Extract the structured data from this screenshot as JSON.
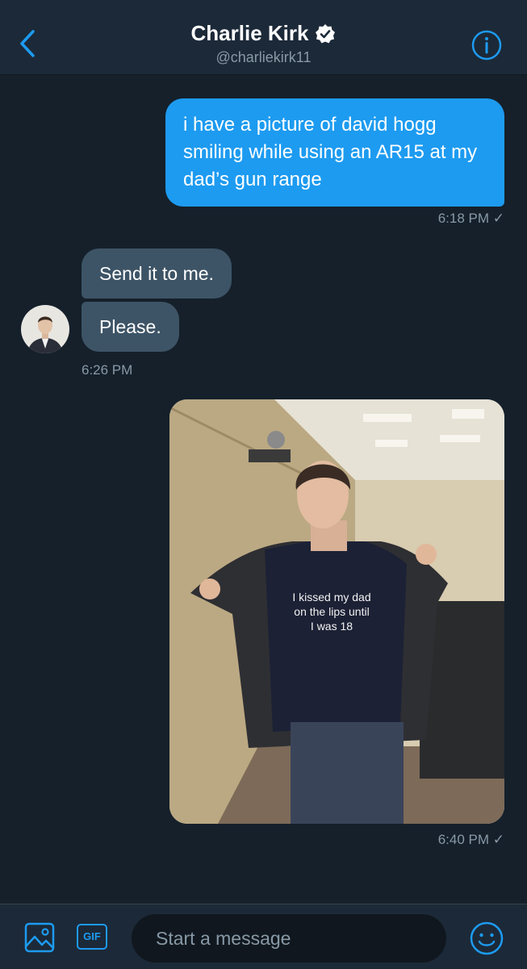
{
  "header": {
    "title": "Charlie Kirk",
    "handle": "@charliekirk11",
    "back_icon": "chevron-left-icon",
    "verified_icon": "verified-badge-icon",
    "info_icon": "info-icon"
  },
  "messages": [
    {
      "direction": "outgoing",
      "type": "text",
      "text": "i have a picture of david hogg smiling while using an AR15 at my dad’s gun range",
      "timestamp": "6:18 PM ✓"
    },
    {
      "direction": "incoming",
      "type": "text",
      "text": "Send it to me."
    },
    {
      "direction": "incoming",
      "type": "text",
      "text": "Please.",
      "timestamp": "6:26 PM"
    },
    {
      "direction": "outgoing",
      "type": "image",
      "image_text": "I kissed my dad on the lips until I was 18",
      "timestamp": "6:40 PM ✓"
    }
  ],
  "composer": {
    "placeholder": "Start a message",
    "gif_label": "GIF",
    "media_icon": "image-icon",
    "emoji_icon": "emoji-icon"
  },
  "colors": {
    "background": "#15202b",
    "header": "#1c2938",
    "accent": "#1d9bf0",
    "incoming_bubble": "#3d5466",
    "muted_text": "#8899a6"
  }
}
